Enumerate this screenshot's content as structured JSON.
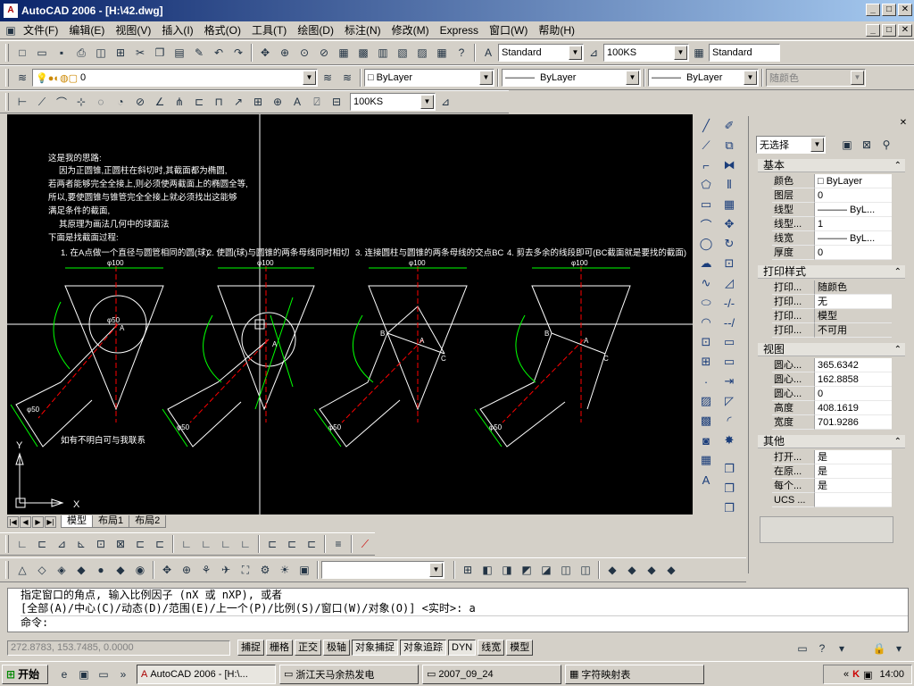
{
  "window": {
    "title": "AutoCAD 2006 - [H:\\42.dwg]",
    "min": "_",
    "max": "□",
    "close": "✕"
  },
  "menu": [
    "文件(F)",
    "编辑(E)",
    "视图(V)",
    "插入(I)",
    "格式(O)",
    "工具(T)",
    "绘图(D)",
    "标注(N)",
    "修改(M)",
    "Express",
    "窗口(W)",
    "帮助(H)"
  ],
  "toolbar": {
    "text_style": "Standard",
    "dim_style": "100KS",
    "table_style": "Standard",
    "layer": "0",
    "color": "ByLayer",
    "linetype": "ByLayer",
    "lineweight": "ByLayer",
    "plotstyle": "随颜色",
    "dim_style2": "100KS",
    "view_combo": ""
  },
  "drawing": {
    "notes": [
      "这是我的思路:",
      "因为正圆锥,正圆柱在斜切时,其截面都为椭圆,",
      "若两者能够完全全接上,则必须使两截面上的椭圆全等,",
      "所以,要使圆锥与锥管完全全接上就必须找出这能够",
      "满足条件的截面,",
      "其原理为画法几何中的球面法",
      "下面是找截面过程:"
    ],
    "steps": [
      "1. 在A点做一个直径与圆管相同的圆(球)",
      "2. 使圆(球)与圆锥的两条母线同时相切",
      "3. 连接圆柱与圆锥的两条母线的交点BC",
      "4. 剪去多余的线段即可(BC截面就是要找的截面)"
    ],
    "dims": [
      "φ100",
      "φ100",
      "φ100",
      "φ100"
    ],
    "circle_label": "φ50",
    "pipe_dims": [
      "φ50",
      "φ50",
      "φ50",
      "φ50"
    ],
    "points": {
      "a": "A",
      "b": "B",
      "c": "C"
    },
    "contact": "如有不明白可与我联系",
    "ucs_x": "X",
    "ucs_y": "Y"
  },
  "layout_tabs": [
    "模型",
    "布局1",
    "布局2"
  ],
  "properties": {
    "selection": "无选择",
    "sections": [
      {
        "title": "基本",
        "rows": [
          [
            "颜色",
            "□ ByLayer"
          ],
          [
            "图层",
            "0"
          ],
          [
            "线型",
            "——— ByL..."
          ],
          [
            "线型...",
            "1"
          ],
          [
            "线宽",
            "——— ByL..."
          ],
          [
            "厚度",
            "0"
          ]
        ]
      },
      {
        "title": "打印样式",
        "rows": [
          [
            "打印...",
            "随颜色"
          ],
          [
            "打印...",
            "无"
          ],
          [
            "打印...",
            "模型"
          ],
          [
            "打印...",
            "不可用"
          ]
        ]
      },
      {
        "title": "视图",
        "rows": [
          [
            "圆心...",
            "365.6342"
          ],
          [
            "圆心...",
            "162.8858"
          ],
          [
            "圆心...",
            "0"
          ],
          [
            "高度",
            "408.1619"
          ],
          [
            "宽度",
            "701.9286"
          ]
        ]
      },
      {
        "title": "其他",
        "rows": [
          [
            "打开...",
            "是"
          ],
          [
            "在原...",
            "是"
          ],
          [
            "每个...",
            "是"
          ],
          [
            "UCS ...",
            ""
          ]
        ]
      }
    ]
  },
  "command": {
    "line1": "指定窗口的角点, 输入比例因子 (nX 或 nXP), 或者",
    "line2": "[全部(A)/中心(C)/动态(D)/范围(E)/上一个(P)/比例(S)/窗口(W)/对象(O)] <实时>: a",
    "prompt": "命令:"
  },
  "status": {
    "coords": "272.8783, 153.7485, 0.0000",
    "buttons": [
      "捕捉",
      "栅格",
      "正交",
      "极轴",
      "对象捕捉",
      "对象追踪",
      "DYN",
      "线宽",
      "模型"
    ]
  },
  "taskbar": {
    "start": "开始",
    "tasks": [
      "AutoCAD 2006 - [H:\\...",
      "浙江天马余热发电",
      "2007_09_24",
      "字符映射表"
    ],
    "time": "14:00"
  },
  "colors": {
    "titlebar": "#0a246a",
    "canvas": "#000000",
    "drawing": "#ffffff",
    "green": "#00ff00",
    "red": "#ff0000"
  }
}
